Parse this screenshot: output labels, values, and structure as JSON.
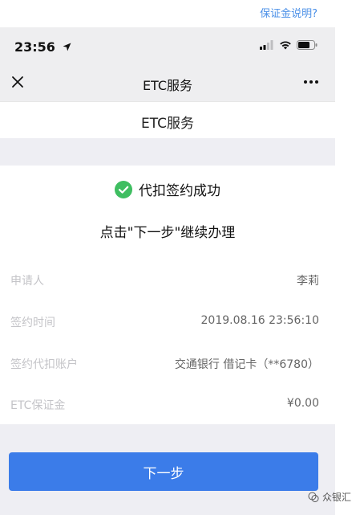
{
  "top_link": "保证金说明?",
  "status_bar": {
    "time": "23:56",
    "icons": [
      "location-arrow-icon",
      "signal-icon",
      "wifi-icon",
      "battery-icon"
    ]
  },
  "nav": {
    "close_icon": "close-icon",
    "title": "ETC服务",
    "more_icon": "more-icon"
  },
  "page": {
    "title": "ETC服务"
  },
  "result": {
    "status_text": "代扣签约成功",
    "status_icon": "check-circle-icon",
    "hint": "点击\"下一步\"继续办理"
  },
  "details": [
    {
      "label": "申请人",
      "value": "李莉"
    },
    {
      "label": "签约时间",
      "value": "2019.08.16 23:56:10"
    },
    {
      "label": "签约代扣账户",
      "value": "交通银行 借记卡（**6780）"
    },
    {
      "label": "ETC保证金",
      "value": "¥0.00"
    }
  ],
  "next_button": "下一步",
  "watermark": "众银汇",
  "colors": {
    "accent": "#3b7ce9",
    "success": "#3fbe61",
    "link": "#4a8fe7"
  }
}
